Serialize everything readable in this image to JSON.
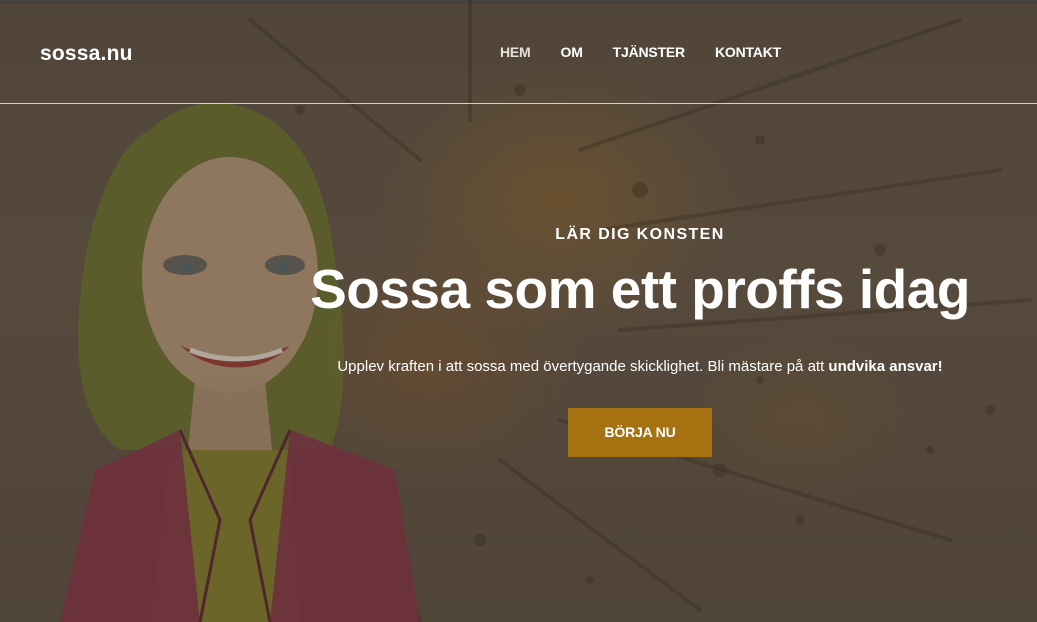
{
  "site": {
    "logo": "sossa.nu"
  },
  "nav": {
    "items": [
      {
        "label": "HEM"
      },
      {
        "label": "OM"
      },
      {
        "label": "TJÄNSTER"
      },
      {
        "label": "KONTAKT"
      }
    ]
  },
  "hero": {
    "eyebrow": "LÄR DIG KONSTEN",
    "title": "Sossa som ett proffs idag",
    "description_start": "Upplev kraften i att sossa med övertygande skicklighet. Bli mästare på att ",
    "description_emphasis": "undvika ansvar!",
    "cta_label": "BÖRJA NU"
  },
  "colors": {
    "overlay": "#5c5043",
    "accent_button": "#a67111",
    "text": "#ffffff"
  }
}
